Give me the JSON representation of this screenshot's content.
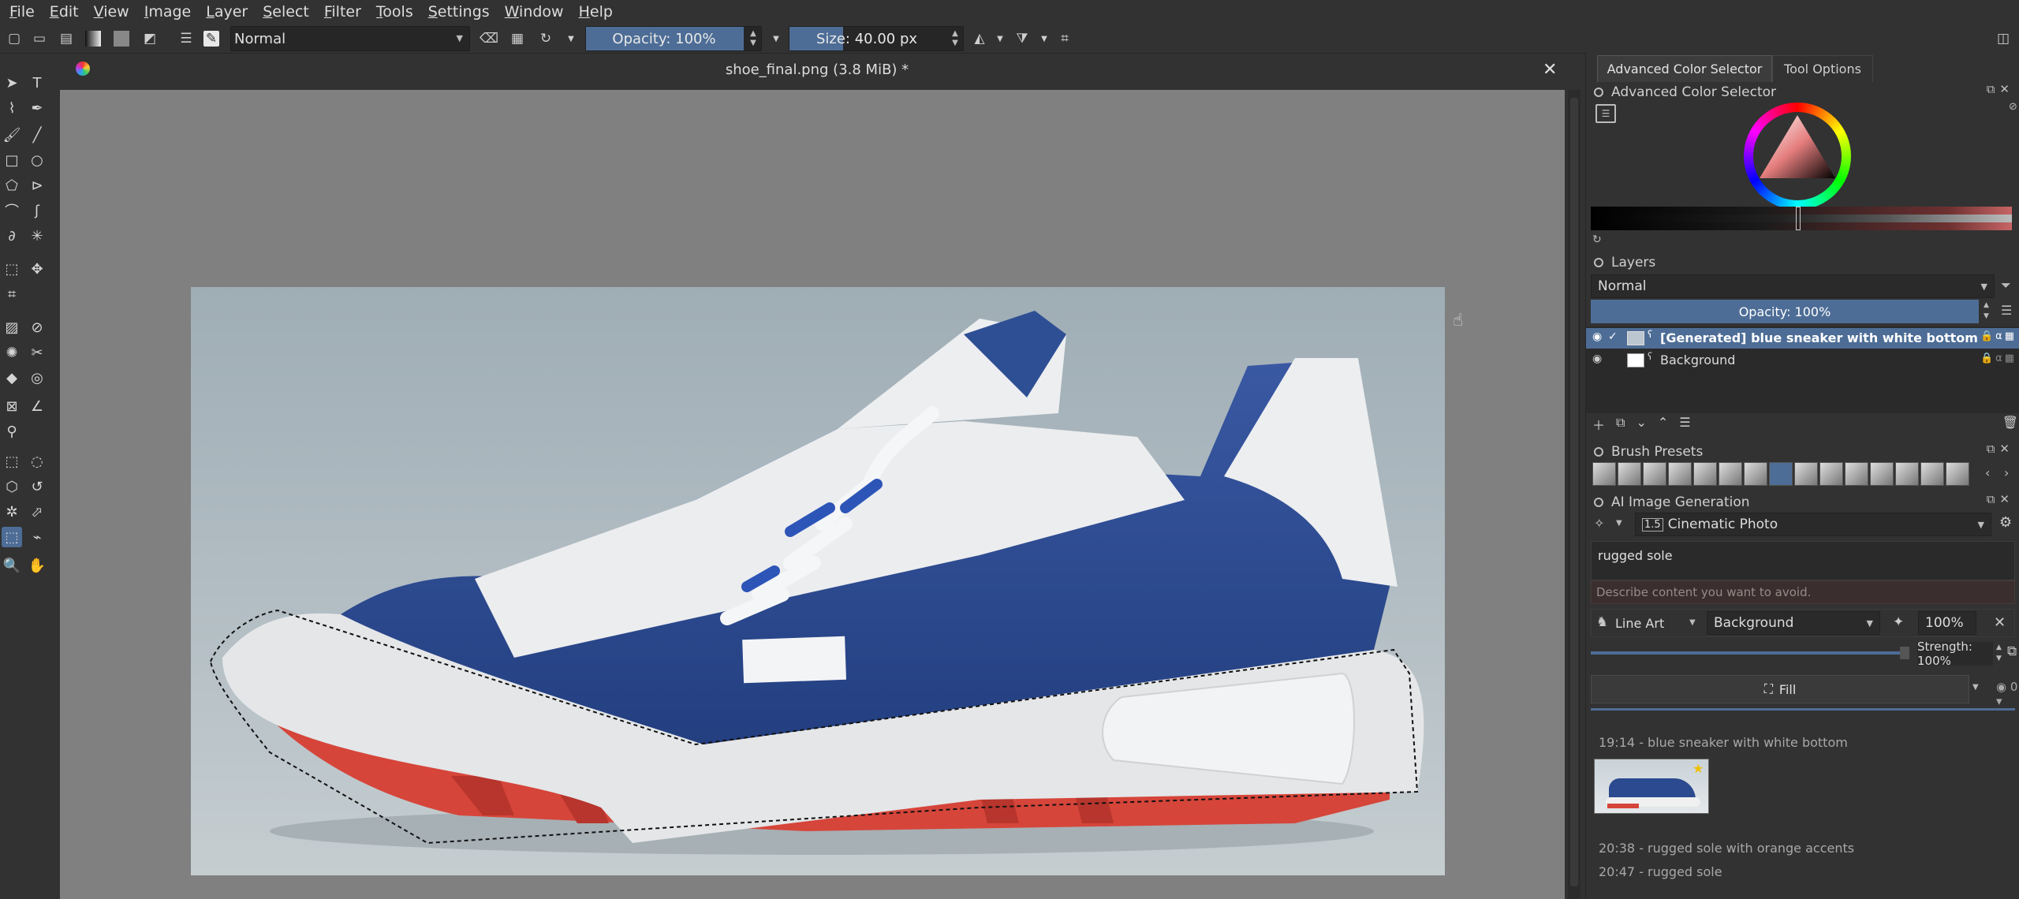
{
  "menu": [
    "File",
    "Edit",
    "View",
    "Image",
    "Layer",
    "Select",
    "Filter",
    "Tools",
    "Settings",
    "Window",
    "Help"
  ],
  "toolbar": {
    "blend_mode": "Normal",
    "opacity": "Opacity: 100%",
    "opacity_value": 1.0,
    "size": "Size: 40.00 px"
  },
  "document": {
    "title": "shoe_final.png (3.8 MiB) *",
    "close_glyph": "✕"
  },
  "dock": {
    "tabs": [
      "Advanced Color Selector",
      "Tool Options"
    ],
    "color_selector": {
      "title": "Advanced Color Selector"
    },
    "layers": {
      "title": "Layers",
      "blend_mode": "Normal",
      "opacity": "Opacity:  100%",
      "items": [
        {
          "name": "[Generated] blue sneaker with white bottom",
          "selected": true
        },
        {
          "name": "Background",
          "selected": false
        }
      ]
    },
    "brush_presets": {
      "title": "Brush Presets",
      "count": 15
    },
    "ai": {
      "title": "AI Image Generation",
      "style": "Cinematic Photo",
      "prompt": "rugged sole",
      "negative_placeholder": "Describe content you want to avoid.",
      "control_type": "Line Art",
      "control_layer": "Background",
      "control_percent": "100%",
      "strength": "Strength: 100%",
      "action": "Fill",
      "batch": "0",
      "history": [
        {
          "label": "19:14 - blue sneaker with white bottom"
        },
        {
          "label": "20:38 - rugged sole with orange accents"
        },
        {
          "label": "20:47 - rugged sole"
        }
      ]
    }
  },
  "colors": {
    "accent": "#4d6d96",
    "panel_bg": "#323232",
    "canvas_bg": "#808080",
    "shoe_blue": "#2b4a8f",
    "sole_red": "#d6453a"
  }
}
